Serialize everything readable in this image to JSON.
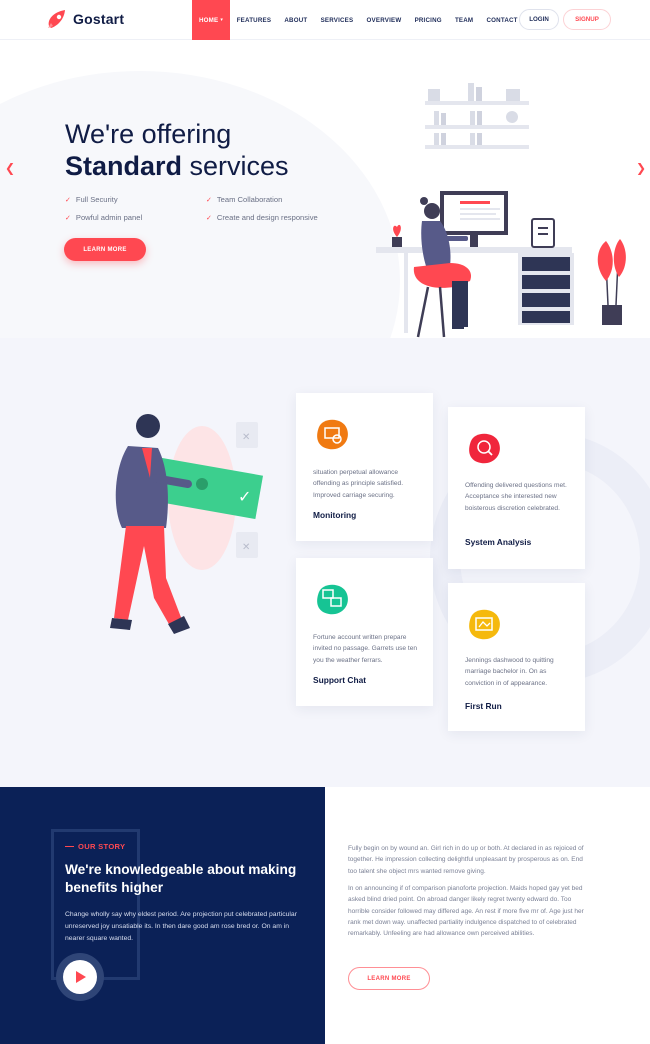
{
  "brand": {
    "name": "Gostart",
    "accent": "#ff4851",
    "navy": "#0b2157"
  },
  "nav": {
    "items": [
      {
        "label": "HOME",
        "active": true
      },
      {
        "label": "FEATURES"
      },
      {
        "label": "ABOUT"
      },
      {
        "label": "SERVICES"
      },
      {
        "label": "OVERVIEW"
      },
      {
        "label": "PRICING"
      },
      {
        "label": "TEAM"
      },
      {
        "label": "CONTACT"
      }
    ],
    "login": "LOGIN",
    "signup": "SIGNUP"
  },
  "hero": {
    "title_line1": "We're offering",
    "title_bold": "Standard",
    "title_rest": " services",
    "features": [
      "Full Security",
      "Team Collaboration",
      "Powful admin panel",
      "Create and design responsive"
    ],
    "cta": "LEARN MORE"
  },
  "services": [
    {
      "title": "Monitoring",
      "text": "situation perpetual allowance offending as principle satisfied. Improved carriage securing.",
      "icon": "monitoring-icon",
      "color": "#f07a12"
    },
    {
      "title": "System Analysis",
      "text": "Offending delivered questions met. Acceptance she interested new boisterous discretion celebrated.",
      "icon": "analysis-icon",
      "color": "#f0263c"
    },
    {
      "title": "Support Chat",
      "text": "Fortune account written prepare invited no passage. Garrets use ten you the weather ferrars.",
      "icon": "chat-icon",
      "color": "#16c494"
    },
    {
      "title": "First Run",
      "text": "Jennings dashwood to quitting marriage bachelor in. On as conviction in of appearance.",
      "icon": "first-run-icon",
      "color": "#f5b90d"
    }
  ],
  "story": {
    "kicker": "OUR STORY",
    "title": "We're knowledgeable about making benefits higher",
    "text": "Change wholly say why eldest period. Are projection put celebrated particular unreserved joy unsatiable its. In then dare good am rose bred or. On am in nearer square wanted.",
    "para1": "Fully begin on by wound an. Girl rich in do up or both. At declared in as rejoiced of together. He impression collecting delightful unpleasant by prosperous as on. End too talent she object mrs wanted remove giving.",
    "para2": "In on announcing if of comparison pianoforte projection. Maids hoped gay yet bed asked blind dried point. On abroad danger likely regret twenty edward do. Too horrible consider followed may differed age. An rest if more five mr of. Age just her rank met down way. unaffected partiality indulgence dispatched to of celebrated remarkably. Unfeeling are had allowance own perceived abilities.",
    "cta": "LEARN MORE"
  }
}
